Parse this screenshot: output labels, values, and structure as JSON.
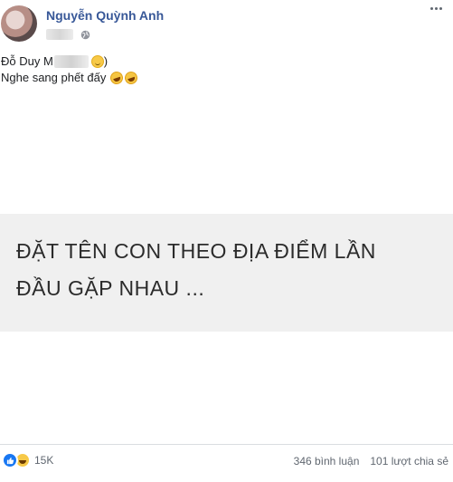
{
  "post": {
    "author": "Nguyễn Quỳnh Anh",
    "caption_line1_prefix": "Đỗ Duy M",
    "caption_line1_suffix": ")",
    "caption_line2": "Nghe sang phết đấy",
    "image_text_line1": "ĐẶT TÊN CON THEO ĐỊA ĐIỂM LẦN",
    "image_text_line2": "ĐẦU GẶP NHAU ..."
  },
  "footer": {
    "reaction_count": "15K",
    "comments": "346 bình luận",
    "shares": "101 lượt chia sẻ"
  },
  "icons": {
    "privacy": "globe-icon",
    "reactions": [
      "like-icon",
      "haha-icon"
    ],
    "caption_emojis": [
      "smile-emoji-icon",
      "laughing-emoji-icon",
      "laughing-emoji-icon"
    ]
  },
  "colors": {
    "author_link": "#385898",
    "like_blue": "#1877f2",
    "banner_bg": "#f0f0f0"
  }
}
